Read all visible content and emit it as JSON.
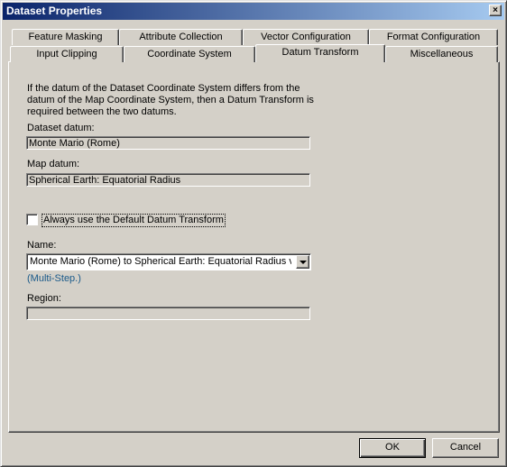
{
  "window": {
    "title": "Dataset Properties",
    "close_glyph": "×"
  },
  "tabs": {
    "row_back": [
      "Feature Masking",
      "Attribute Collection",
      "Vector Configuration",
      "Format Configuration"
    ],
    "row_front": [
      "Input Clipping",
      "Coordinate System",
      "Datum Transform",
      "Miscellaneous"
    ],
    "active": "Datum Transform"
  },
  "datum": {
    "description": "If the datum of the Dataset Coordinate System differs from the datum of the Map Coordinate System, then a Datum Transform is required between the two datums.",
    "dataset_label": "Dataset datum:",
    "dataset_value": "Monte Mario (Rome)",
    "map_label": "Map datum:",
    "map_value": "Spherical Earth: Equatorial Radius",
    "default_checkbox_label": "Always use the Default Datum Transform",
    "default_checked": false,
    "name_label": "Name:",
    "name_value": "Monte Mario (Rome) to Spherical Earth: Equatorial Radius via",
    "name_note": "(Multi-Step.)",
    "region_label": "Region:",
    "region_value": ""
  },
  "buttons": {
    "ok": "OK",
    "cancel": "Cancel"
  }
}
